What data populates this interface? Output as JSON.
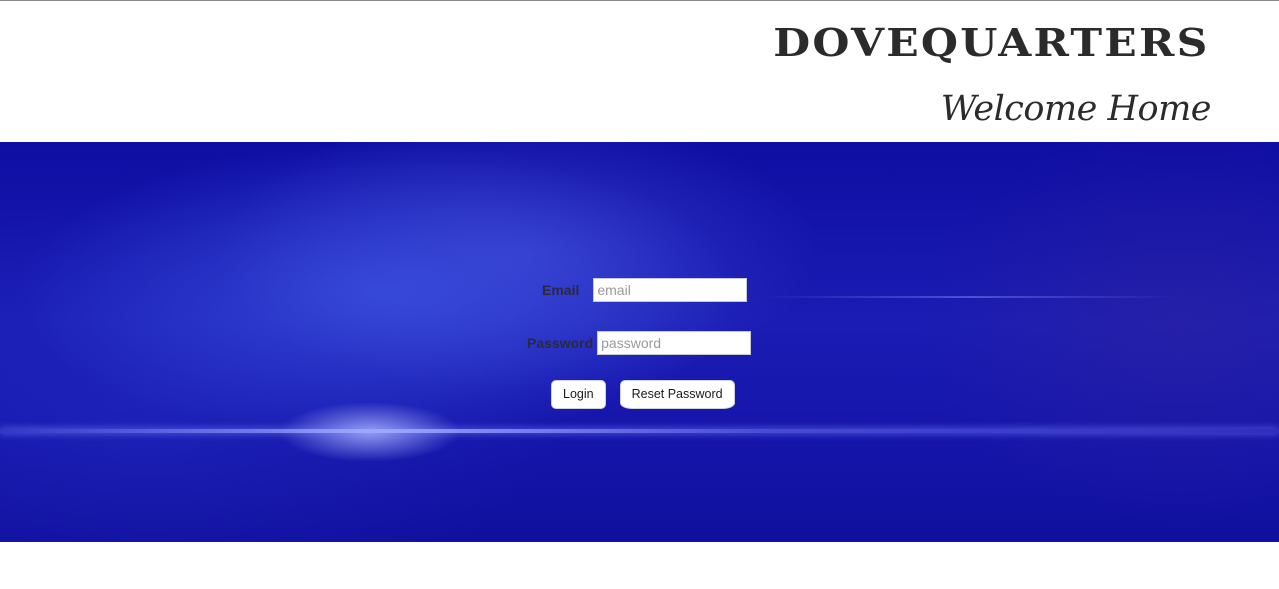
{
  "header": {
    "brand": "DOVEQUARTERS",
    "tagline": "Welcome Home"
  },
  "login_form": {
    "email": {
      "label": "Email",
      "placeholder": "email",
      "value": ""
    },
    "password": {
      "label": "Password",
      "placeholder": "password",
      "value": ""
    },
    "login_button": "Login",
    "reset_button": "Reset Password"
  },
  "colors": {
    "hero_background": "#1414aa",
    "header_text": "#2b2b2b"
  }
}
